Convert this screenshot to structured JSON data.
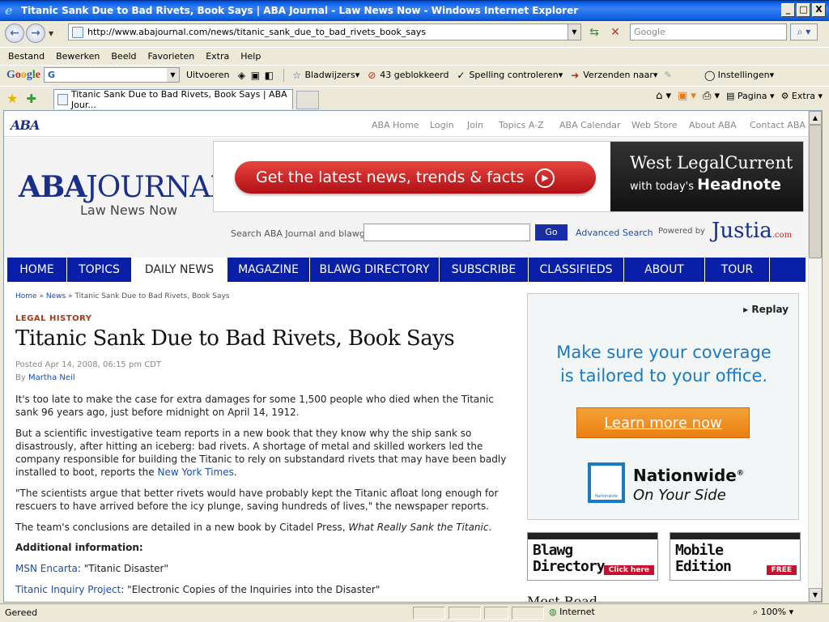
{
  "window": {
    "title": "Titanic Sank Due to Bad Rivets, Book Says | ABA Journal - Law News Now - Windows Internet Explorer",
    "minimize": "_",
    "maximize": "□",
    "close": "X"
  },
  "address": {
    "url": "http://www.abajournal.com/news/titanic_sank_due_to_bad_rivets_book_says",
    "search_placeholder": "Google"
  },
  "menu": [
    "Bestand",
    "Bewerken",
    "Beeld",
    "Favorieten",
    "Extra",
    "Help"
  ],
  "google_toolbar": {
    "search_value": "G",
    "run_label": "Uitvoeren",
    "bookmarks": "Bladwijzers",
    "blocked": "43 geblokkeerd",
    "spellcheck": "Spelling controleren",
    "send_to": "Verzenden naar",
    "settings": "Instellingen"
  },
  "tabs": {
    "active_title": "Titanic Sank Due to Bad Rivets, Book Says | ABA Jour...",
    "page_label": "Pagina",
    "extra_label": "Extra"
  },
  "site": {
    "mini_logo": "ABA",
    "util_links": [
      "ABA Home",
      "Login",
      "Join",
      "Topics A-Z",
      "ABA Calendar",
      "Web Store",
      "About ABA",
      "Contact ABA"
    ],
    "logo_aba": "ABA",
    "logo_journal": "JOURNAL",
    "logo_tagline": "Law News Now",
    "banner": {
      "cta": "Get the latest news, trends & facts",
      "brand_line1": "West LegalCurrent",
      "brand_line2_pre": "with today's",
      "brand_line2_bold": "Headnote"
    },
    "search": {
      "label": "Search ABA Journal and blawgs",
      "go": "Go",
      "advanced": "Advanced Search",
      "powered_by": "Powered by",
      "justia": "Justia",
      "justia_suffix": ".com"
    },
    "nav": [
      "HOME",
      "TOPICS",
      "DAILY NEWS",
      "MAGAZINE",
      "BLAWG DIRECTORY",
      "SUBSCRIBE",
      "CLASSIFIEDS",
      "ABOUT",
      "TOUR"
    ],
    "nav_active": 2
  },
  "article": {
    "breadcrumb": {
      "home": "Home",
      "news": "News",
      "sep": "»",
      "current": "Titanic Sank Due to Bad Rivets, Book Says"
    },
    "kicker": "LEGAL HISTORY",
    "title": "Titanic Sank Due to Bad Rivets, Book Says",
    "posted": "Posted Apr 14, 2008, 06:15 pm CDT",
    "by": "By",
    "author": "Martha Neil",
    "p1": "It's too late to make the case for extra damages for some 1,500 people who died when the Titanic sank 96 years ago, just before midnight on April 14, 1912.",
    "p2": "But a scientific investigative team reports in a new book that they know why the ship sank so disastrously, after hitting an iceberg: bad rivets. A shortage of metal and skilled workers led the company responsible for building the Titanic to rely on substandard rivets that may have been badly installed to boot, reports the",
    "p2_link": "New York Times",
    "p2_end": ".",
    "p3": "\"The scientists argue that better rivets would have probably kept the Titanic afloat long enough for rescuers to have arrived before the icy plunge, saving hundreds of lives,\" the newspaper reports.",
    "p4_pre": "The team's conclusions are detailed in a new book by Citadel Press,",
    "p4_book": "What Really Sank the Titanic",
    "p4_end": ".",
    "additional": "Additional information:",
    "link1": "MSN Encarta",
    "link1_desc": ": \"Titanic Disaster\"",
    "link2": "Titanic Inquiry Project",
    "link2_desc": ": \"Electronic Copies of the Inquiries into the Disaster\""
  },
  "sidebar": {
    "ad": {
      "replay": "▸ Replay",
      "line1": "Make sure your coverage",
      "line2": "is tailored to your office.",
      "cta": "Learn more now",
      "box_label": "Nationwide",
      "brand": "Nationwide",
      "registered": "®",
      "slogan": "On Your Side"
    },
    "promo1": {
      "line1": "Blawg",
      "line2": "Directory",
      "badge": "Click here"
    },
    "promo2": {
      "line1": "Mobile",
      "line2": "Edition",
      "badge": "FREE"
    },
    "peek": "Most Read"
  },
  "status": {
    "text": "Gereed",
    "zone": "Internet",
    "zoom": "100%"
  },
  "colors": {
    "nav": "#0A1FA8",
    "accent_red": "#C8102E",
    "link": "#1A4DB0"
  }
}
